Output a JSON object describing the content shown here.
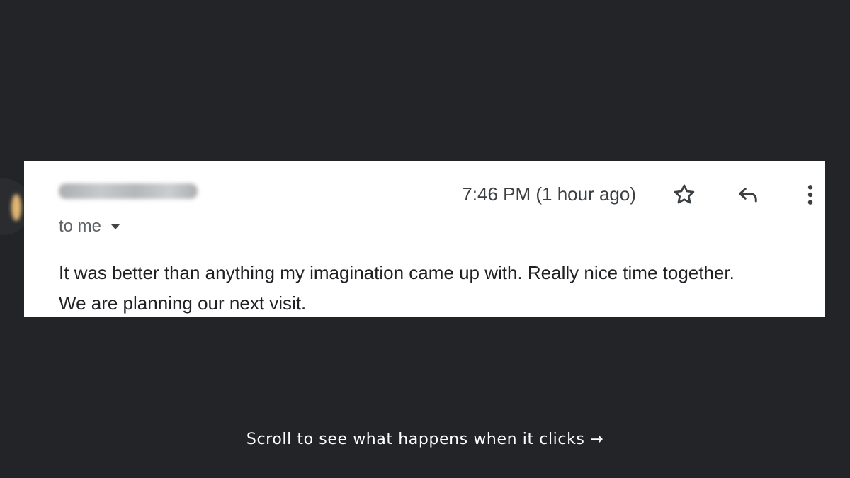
{
  "email": {
    "recipient_label": "to me",
    "timestamp": "7:46 PM (1 hour ago)",
    "body_line_1": "It was better than anything my imagination came up with. Really nice time together.",
    "body_line_2": "We are planning our next visit.",
    "icons": {
      "recipient_toggle": "chevron-down-icon",
      "star": "star-icon",
      "reply": "reply-icon",
      "more": "more-vertical-icon"
    }
  },
  "caption": "Scroll to see what happens when it clicks →",
  "colors": {
    "page_background": "#222427",
    "card_background": "#ffffff",
    "text_primary": "#202124",
    "text_secondary": "#5f6368"
  }
}
